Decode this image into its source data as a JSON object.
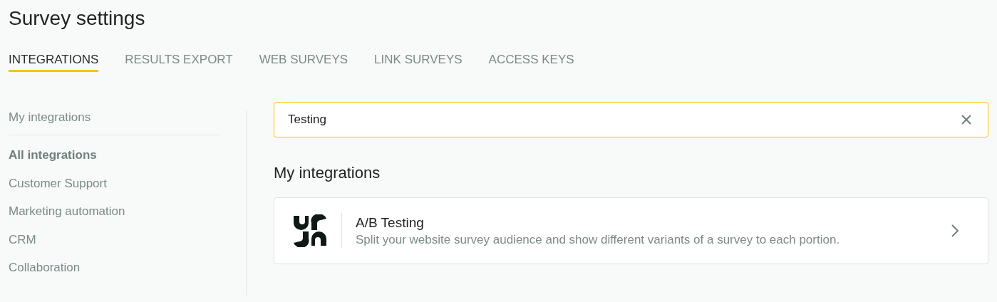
{
  "title": "Survey settings",
  "tabs": [
    {
      "label": "INTEGRATIONS",
      "selected": true
    },
    {
      "label": "RESULTS EXPORT",
      "selected": false
    },
    {
      "label": "WEB SURVEYS",
      "selected": false
    },
    {
      "label": "LINK SURVEYS",
      "selected": false
    },
    {
      "label": "ACCESS KEYS",
      "selected": false
    }
  ],
  "sidebar": {
    "top": [
      {
        "label": "My integrations",
        "selected": false
      }
    ],
    "categories": [
      {
        "label": "All integrations",
        "selected": true
      },
      {
        "label": "Customer Support",
        "selected": false
      },
      {
        "label": "Marketing automation",
        "selected": false
      },
      {
        "label": "CRM",
        "selected": false
      },
      {
        "label": "Collaboration",
        "selected": false
      }
    ]
  },
  "search": {
    "value": "Testing"
  },
  "section_title": "My integrations",
  "integrations": [
    {
      "name": "A/B Testing",
      "description": "Split your website survey audience and show different variants of a survey to each portion."
    }
  ]
}
